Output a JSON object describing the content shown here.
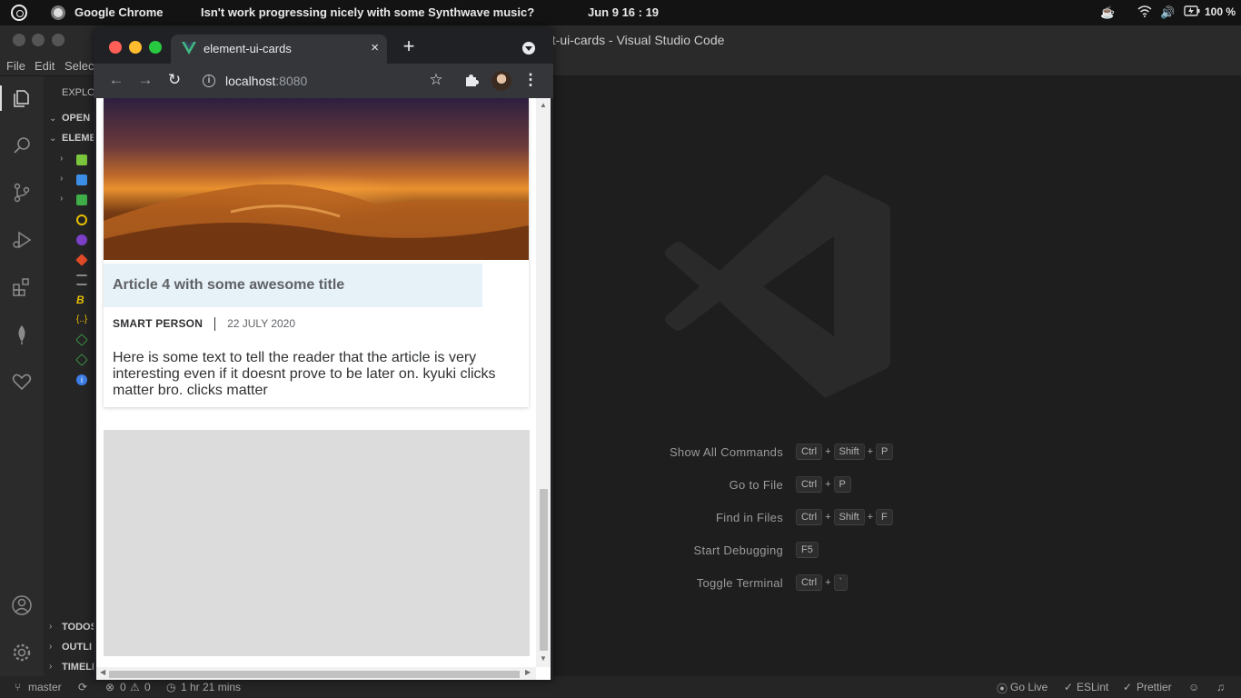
{
  "topbar": {
    "app_name": "Google Chrome",
    "notification": "Isn't work progressing nicely with some Synthwave music?",
    "clock": "Jun 9  16 : 19",
    "battery": "100 %"
  },
  "vscode": {
    "window_title": "nt-ui-cards - Visual Studio Code",
    "menu": [
      "File",
      "Edit",
      "Selec"
    ],
    "explorer": {
      "header": "EXPLO",
      "open_editors": "OPEN E",
      "project": "ELEME",
      "bottom_sections": [
        "TODOS",
        "OUTLI",
        "TIMELI"
      ]
    },
    "shortcuts": [
      {
        "label": "Show All Commands",
        "keys": [
          "Ctrl",
          "Shift",
          "P"
        ]
      },
      {
        "label": "Go to File",
        "keys": [
          "Ctrl",
          "P"
        ]
      },
      {
        "label": "Find in Files",
        "keys": [
          "Ctrl",
          "Shift",
          "F"
        ]
      },
      {
        "label": "Start Debugging",
        "keys": [
          "F5"
        ]
      },
      {
        "label": "Toggle Terminal",
        "keys": [
          "Ctrl",
          "`"
        ]
      }
    ],
    "status": {
      "branch": "master",
      "errors": "0",
      "warnings": "0",
      "time": "1 hr 21 mins",
      "go_live": "Go Live",
      "eslint": "ESLint",
      "prettier": "Prettier"
    }
  },
  "chrome": {
    "tab_title": "element-ui-cards",
    "url_host": "localhost",
    "url_port": ":8080"
  },
  "card": {
    "title": "Article 4 with some awesome title",
    "author": "SMART PERSON",
    "date": "22 JULY 2020",
    "body": "Here is some text to tell the reader that the article is very interesting even if it doesnt prove to be later on. kyuki clicks matter bro. clicks matter"
  },
  "colors": {
    "title_bg": "#e6f1f8",
    "vue_green": "#41b883",
    "vue_dark": "#35495e"
  }
}
